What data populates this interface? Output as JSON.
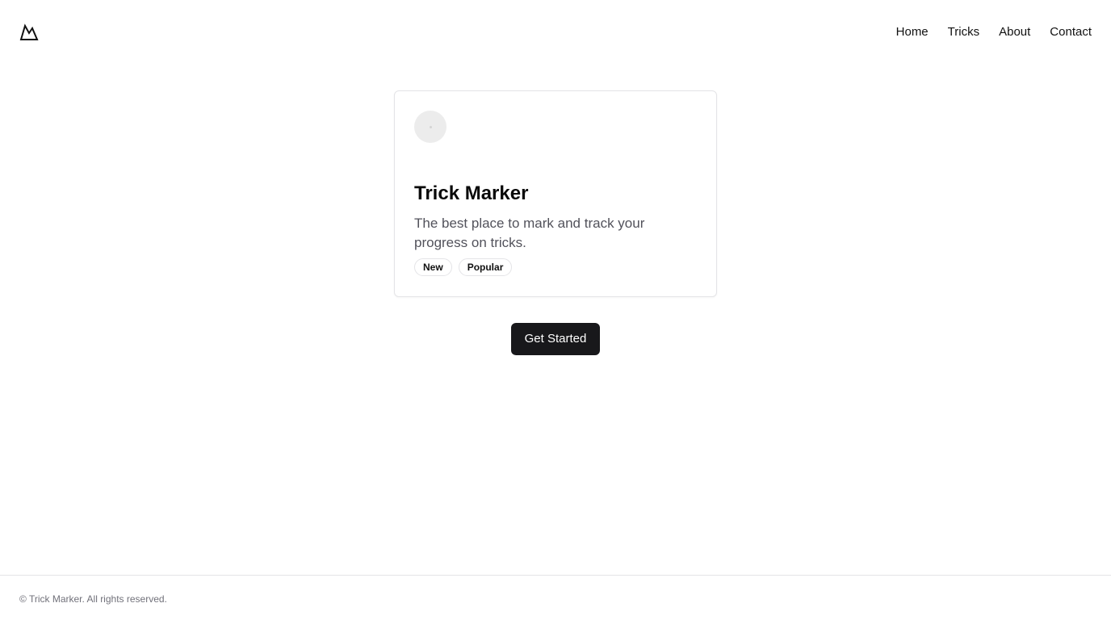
{
  "header": {
    "logo_icon": "mountain-logo-icon",
    "nav": [
      {
        "label": "Home"
      },
      {
        "label": "Tricks"
      },
      {
        "label": "About"
      },
      {
        "label": "Contact"
      }
    ]
  },
  "card": {
    "avatar_icon": "avatar-placeholder-icon",
    "title": "Trick Marker",
    "description": "The best place to mark and track your progress on tricks.",
    "badges": [
      {
        "label": "New"
      },
      {
        "label": "Popular"
      }
    ]
  },
  "cta": {
    "label": "Get Started"
  },
  "footer": {
    "copyright": "© Trick Marker. All rights reserved."
  },
  "colors": {
    "primary_button": "#18181b",
    "border": "#e4e4e7",
    "muted_text": "#52525b",
    "footer_text": "#71717a"
  }
}
